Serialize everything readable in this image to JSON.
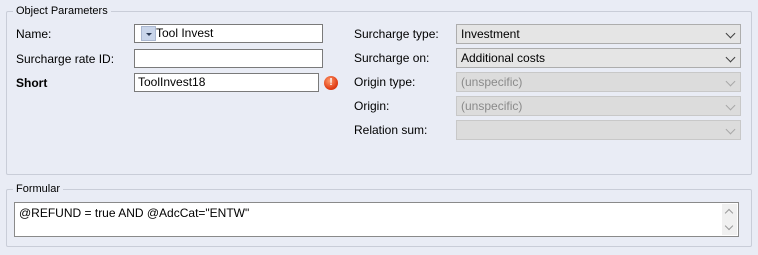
{
  "object_parameters": {
    "title": "Object Parameters",
    "name_label": "Name:",
    "name_value": "Tool Invest",
    "surcharge_rate_id_label": "Surcharge rate ID:",
    "surcharge_rate_id_value": "",
    "short_label": "Short",
    "short_value": "ToolInvest18",
    "surcharge_type_label": "Surcharge type:",
    "surcharge_type_value": "Investment",
    "surcharge_on_label": "Surcharge on:",
    "surcharge_on_value": "Additional costs",
    "origin_type_label": "Origin type:",
    "origin_type_value": "(unspecific)",
    "origin_label": "Origin:",
    "origin_value": "(unspecific)",
    "relation_sum_label": "Relation sum:",
    "relation_sum_value": ""
  },
  "formular": {
    "title": "Formular",
    "value": "@REFUND = true AND @AdcCat=\"ENTW\""
  },
  "colors": {
    "background": "#e9ecf5",
    "warning": "#e03c14"
  },
  "icons": {
    "short_warning": "exclamation-warning-icon"
  }
}
